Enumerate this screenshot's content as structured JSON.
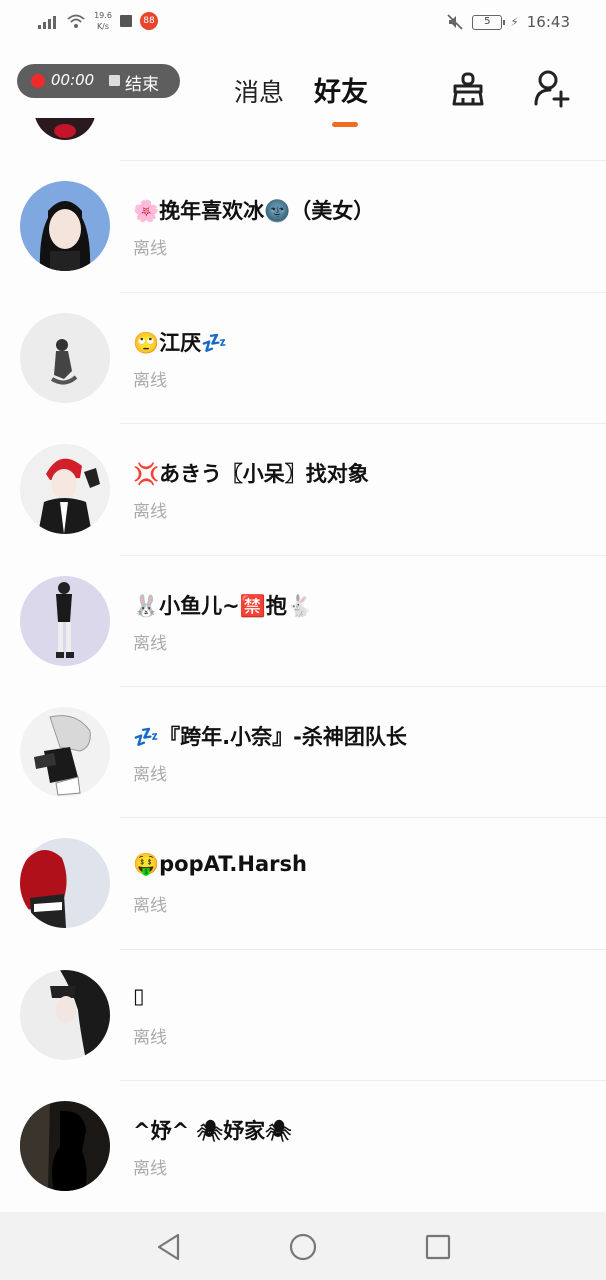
{
  "status_bar": {
    "speed_top": "19.6",
    "speed_bottom": "K/s",
    "app_badge": "88",
    "battery": "5",
    "time": "16:43"
  },
  "recorder": {
    "time": "00:00",
    "end_label": "结束"
  },
  "tabs": [
    {
      "label": "消息",
      "active": false
    },
    {
      "label": "好友",
      "active": true
    }
  ],
  "icons": {
    "clean": "broom-icon",
    "add_friend": "add-user-icon"
  },
  "accent_color": "#f26b22",
  "friends": [
    {
      "name": "🌸挽年喜欢冰🌚（美女）",
      "status": "离线"
    },
    {
      "name": "🙄江厌💤",
      "status": "离线"
    },
    {
      "name": "💢あきう〖小呆〗找对象",
      "status": "离线"
    },
    {
      "name": "🐰小鱼儿~🈲抱🐇",
      "status": "离线"
    },
    {
      "name": "💤『跨年.小奈』-杀神团队长",
      "status": "离线"
    },
    {
      "name": "🤑popAT.Harsh",
      "status": "离线"
    },
    {
      "name": "▯",
      "status": "离线"
    },
    {
      "name": "^妤^ 🕷妤家🕷",
      "status": "离线"
    }
  ]
}
